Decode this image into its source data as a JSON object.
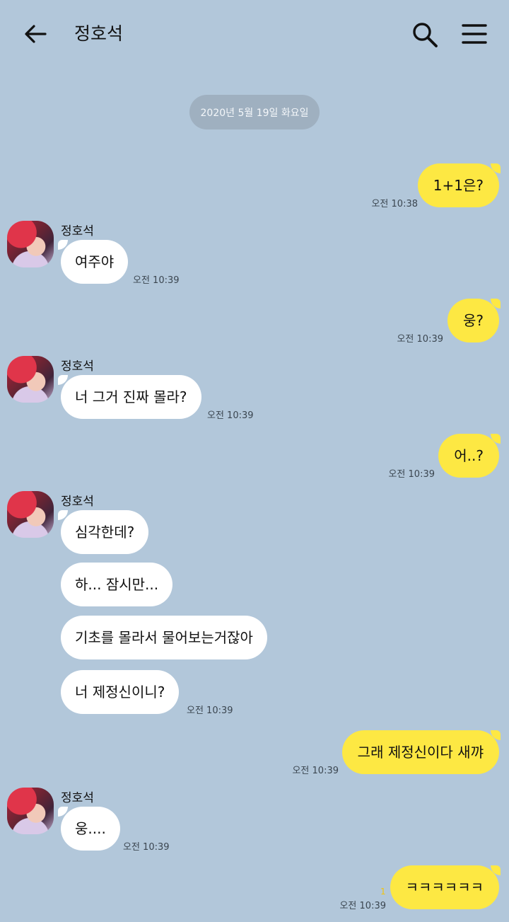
{
  "header": {
    "back_icon": "arrow-left-icon",
    "title": "정호석",
    "search_icon": "search-icon",
    "menu_icon": "hamburger-menu-icon"
  },
  "date_divider": "2020년 5월 19일 화요일",
  "colors": {
    "background": "#b2c7da",
    "my_bubble": "#fde843",
    "their_bubble": "#ffffff",
    "date_pill": "#9fb0c0",
    "unread_count": "#f1c40f"
  },
  "messages": {
    "m1": {
      "text": "1+1은?",
      "time": "오전 10:38"
    },
    "s1": {
      "name": "정호석"
    },
    "t1": {
      "text": "여주야",
      "time": "오전 10:39"
    },
    "m2": {
      "text": "웅?",
      "time": "오전 10:39"
    },
    "s2": {
      "name": "정호석"
    },
    "t2": {
      "text": "너 그거 진짜 몰라?",
      "time": "오전 10:39"
    },
    "m3": {
      "text": "어..?",
      "time": "오전 10:39"
    },
    "s3": {
      "name": "정호석"
    },
    "t3a": {
      "text": "심각한데?"
    },
    "t3b": {
      "text": "하... 잠시만..."
    },
    "t3c": {
      "text": "기초를 몰라서 물어보는거잖아"
    },
    "t3d": {
      "text": "너 제정신이니?",
      "time": "오전 10:39"
    },
    "m4": {
      "text": "그래 제정신이다 새꺄",
      "time": "오전 10:39"
    },
    "s4": {
      "name": "정호석"
    },
    "t4": {
      "text": "웅....",
      "time": "오전 10:39"
    },
    "m5": {
      "text": "ㅋㅋㅋㅋㅋㅋ",
      "time": "오전 10:39",
      "unread": "1"
    }
  }
}
